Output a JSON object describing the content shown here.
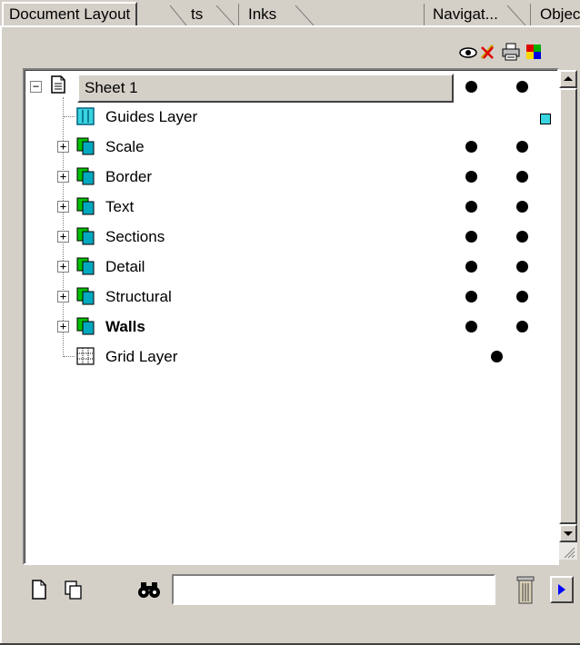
{
  "tabs": [
    {
      "label": "Document Layout",
      "active": true
    },
    {
      "label": "ts",
      "active": false
    },
    {
      "label": "Inks",
      "active": false
    },
    {
      "label": "Navigat...",
      "active": false
    },
    {
      "label": "Objec",
      "active": false
    }
  ],
  "column_icons": [
    "eye-icon",
    "lock-icon",
    "printer-icon",
    "color-icon"
  ],
  "tree": {
    "root": {
      "label": "Sheet 1",
      "selected": true,
      "visible": true,
      "printable": true
    },
    "items": [
      {
        "label": "Guides Layer",
        "type": "guides-layer",
        "bold": false,
        "color_swatch": true
      },
      {
        "label": "Scale",
        "type": "layer",
        "bold": false,
        "visible": true,
        "printable": true
      },
      {
        "label": "Border",
        "type": "layer",
        "bold": false,
        "visible": true,
        "printable": true
      },
      {
        "label": "Text",
        "type": "layer",
        "bold": false,
        "visible": true,
        "printable": true
      },
      {
        "label": "Sections",
        "type": "layer",
        "bold": false,
        "visible": true,
        "printable": true
      },
      {
        "label": "Detail",
        "type": "layer",
        "bold": false,
        "visible": true,
        "printable": true
      },
      {
        "label": "Structural",
        "type": "layer",
        "bold": false,
        "visible": true,
        "printable": true
      },
      {
        "label": "Walls",
        "type": "layer",
        "bold": true,
        "visible": true,
        "printable": true
      },
      {
        "label": "Grid Layer",
        "type": "grid-layer",
        "bold": false
      }
    ]
  },
  "colors": {
    "swatch": "#38d4e0",
    "accent": "#0000ff"
  },
  "search": {
    "value": "",
    "placeholder": ""
  }
}
